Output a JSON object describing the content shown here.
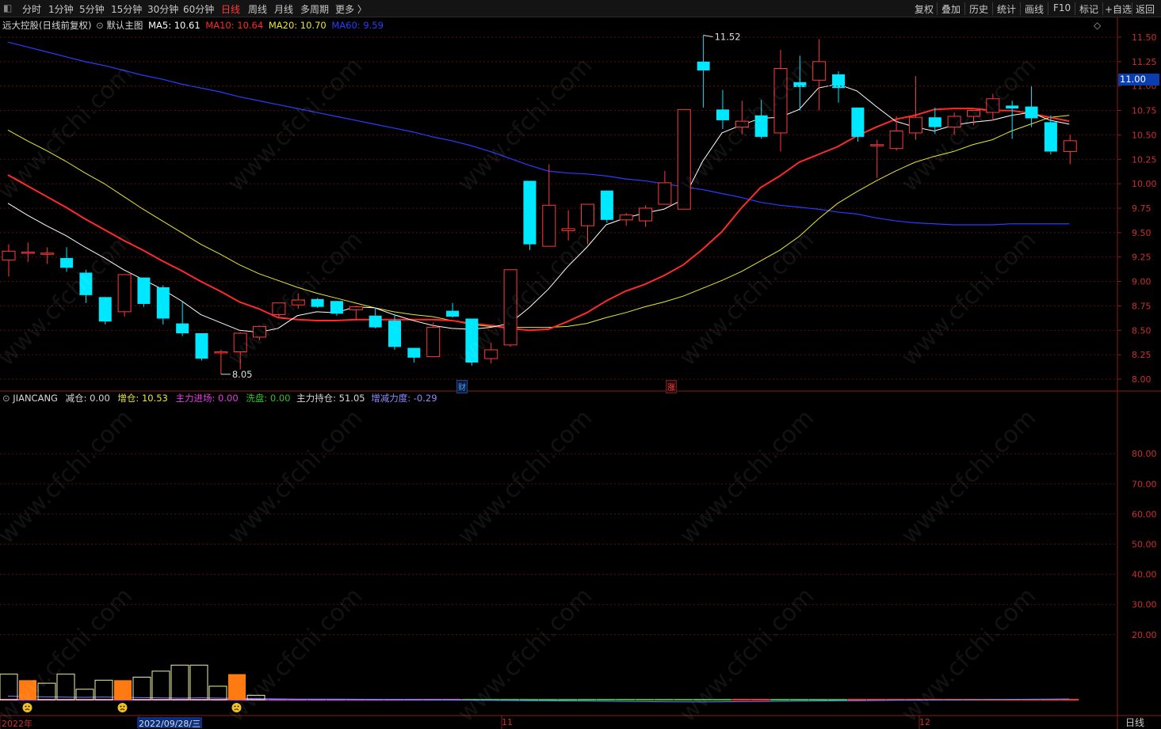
{
  "toolbar": {
    "collapse_icon": "collapse-icon",
    "periods": [
      "分时",
      "1分钟",
      "5分钟",
      "15分钟",
      "30分钟",
      "60分钟",
      "日线",
      "周线",
      "月线",
      "多周期",
      "更多 〉"
    ],
    "active_period": "日线",
    "right_buttons": [
      "复权",
      "叠加",
      "历史",
      "统计",
      "画线",
      "F10",
      "标记",
      "+自选",
      "返回"
    ]
  },
  "main_legend": {
    "stock": "远大控股",
    "mode": "(日线前复权)",
    "chart_name": "默认主图",
    "ma5": "MA5: 10.61",
    "ma10": "MA10: 10.64",
    "ma20": "MA20: 10.70",
    "ma60": "MA60: 9.59",
    "colors": {
      "ma5": "#ffffff",
      "ma10": "#ff2a2a",
      "ma20": "#e8e830",
      "ma60": "#2a3cff"
    }
  },
  "sub_legend": {
    "name": "JIANCANG",
    "jiancang": "减仓: 0.00",
    "zengcang": "增仓: 10.53",
    "zhuli_jinchang": "主力进场: 0.00",
    "xipan": "洗盘: 0.00",
    "zhuli_chicang": "主力持仓: 51.05",
    "zengjian_lidu": "增减力度: -0.29"
  },
  "price_axis": [
    "11.50",
    "11.25",
    "11.00",
    "10.75",
    "10.50",
    "10.25",
    "10.00",
    "9.75",
    "9.50",
    "9.25",
    "9.00",
    "8.75",
    "8.50",
    "8.25",
    "8.00"
  ],
  "indicator_axis": [
    "80.00",
    "70.00",
    "60.00",
    "50.00",
    "40.00",
    "30.00",
    "20.00"
  ],
  "current_price_label": "11.00",
  "high_annotation": "11.52",
  "low_annotation": "8.05",
  "markers": {
    "cai": "财",
    "zhang": "涨"
  },
  "x_labels": {
    "year": "2022年",
    "cursor_date": "2022/09/28/三",
    "nov": "11",
    "dec": "12"
  },
  "period_label": "日线",
  "watermark": "www.cfchi.com",
  "chart_data": {
    "type": "candlestick",
    "price_range": [
      8.0,
      11.5
    ],
    "candles": [
      {
        "o": 9.22,
        "h": 9.38,
        "l": 9.05,
        "c": 9.31
      },
      {
        "o": 9.3,
        "h": 9.4,
        "l": 9.2,
        "c": 9.3
      },
      {
        "o": 9.28,
        "h": 9.35,
        "l": 9.18,
        "c": 9.29
      },
      {
        "o": 9.24,
        "h": 9.35,
        "l": 9.1,
        "c": 9.14
      },
      {
        "o": 9.09,
        "h": 9.12,
        "l": 8.78,
        "c": 8.86
      },
      {
        "o": 8.84,
        "h": 8.84,
        "l": 8.56,
        "c": 8.59
      },
      {
        "o": 8.69,
        "h": 9.07,
        "l": 8.64,
        "c": 9.07
      },
      {
        "o": 9.04,
        "h": 9.04,
        "l": 8.74,
        "c": 8.77
      },
      {
        "o": 8.94,
        "h": 8.96,
        "l": 8.56,
        "c": 8.62
      },
      {
        "o": 8.57,
        "h": 8.79,
        "l": 8.44,
        "c": 8.47
      },
      {
        "o": 8.47,
        "h": 8.47,
        "l": 8.19,
        "c": 8.21
      },
      {
        "o": 8.28,
        "h": 8.3,
        "l": 8.05,
        "c": 8.28
      },
      {
        "o": 8.28,
        "h": 8.48,
        "l": 8.1,
        "c": 8.47
      },
      {
        "o": 8.43,
        "h": 8.55,
        "l": 8.4,
        "c": 8.54
      },
      {
        "o": 8.66,
        "h": 8.78,
        "l": 8.63,
        "c": 8.78
      },
      {
        "o": 8.76,
        "h": 8.88,
        "l": 8.72,
        "c": 8.81
      },
      {
        "o": 8.82,
        "h": 8.83,
        "l": 8.73,
        "c": 8.74
      },
      {
        "o": 8.8,
        "h": 8.8,
        "l": 8.65,
        "c": 8.67
      },
      {
        "o": 8.71,
        "h": 8.75,
        "l": 8.6,
        "c": 8.74
      },
      {
        "o": 8.65,
        "h": 8.73,
        "l": 8.52,
        "c": 8.53
      },
      {
        "o": 8.6,
        "h": 8.66,
        "l": 8.3,
        "c": 8.33
      },
      {
        "o": 8.32,
        "h": 8.32,
        "l": 8.17,
        "c": 8.22
      },
      {
        "o": 8.23,
        "h": 8.58,
        "l": 8.23,
        "c": 8.53
      },
      {
        "o": 8.7,
        "h": 8.78,
        "l": 8.63,
        "c": 8.64
      },
      {
        "o": 8.62,
        "h": 8.62,
        "l": 8.14,
        "c": 8.17
      },
      {
        "o": 8.21,
        "h": 8.37,
        "l": 8.16,
        "c": 8.3
      },
      {
        "o": 8.35,
        "h": 9.12,
        "l": 8.33,
        "c": 9.12
      },
      {
        "o": 10.03,
        "h": 10.03,
        "l": 9.32,
        "c": 9.38
      },
      {
        "o": 9.36,
        "h": 10.2,
        "l": 9.36,
        "c": 9.78
      },
      {
        "o": 9.52,
        "h": 9.73,
        "l": 9.42,
        "c": 9.54
      },
      {
        "o": 9.57,
        "h": 9.79,
        "l": 9.38,
        "c": 9.79
      },
      {
        "o": 9.93,
        "h": 9.93,
        "l": 9.6,
        "c": 9.63
      },
      {
        "o": 9.63,
        "h": 9.7,
        "l": 9.57,
        "c": 9.68
      },
      {
        "o": 9.62,
        "h": 9.78,
        "l": 9.56,
        "c": 9.75
      },
      {
        "o": 9.79,
        "h": 10.13,
        "l": 9.79,
        "c": 10.01
      },
      {
        "o": 9.74,
        "h": 10.76,
        "l": 9.74,
        "c": 10.76
      },
      {
        "o": 11.25,
        "h": 11.52,
        "l": 10.78,
        "c": 11.16
      },
      {
        "o": 10.76,
        "h": 10.96,
        "l": 10.56,
        "c": 10.65
      },
      {
        "o": 10.58,
        "h": 10.85,
        "l": 10.51,
        "c": 10.64
      },
      {
        "o": 10.7,
        "h": 10.86,
        "l": 10.46,
        "c": 10.48
      },
      {
        "o": 10.52,
        "h": 11.37,
        "l": 10.33,
        "c": 11.18
      },
      {
        "o": 11.04,
        "h": 11.31,
        "l": 10.75,
        "c": 10.99
      },
      {
        "o": 11.06,
        "h": 11.48,
        "l": 10.75,
        "c": 11.25
      },
      {
        "o": 11.12,
        "h": 11.15,
        "l": 10.83,
        "c": 10.98
      },
      {
        "o": 10.78,
        "h": 10.78,
        "l": 10.43,
        "c": 10.48
      },
      {
        "o": 10.4,
        "h": 10.45,
        "l": 10.06,
        "c": 10.4
      },
      {
        "o": 10.36,
        "h": 10.69,
        "l": 10.34,
        "c": 10.54
      },
      {
        "o": 10.52,
        "h": 11.1,
        "l": 10.45,
        "c": 10.68
      },
      {
        "o": 10.68,
        "h": 10.78,
        "l": 10.51,
        "c": 10.58
      },
      {
        "o": 10.58,
        "h": 10.73,
        "l": 10.5,
        "c": 10.69
      },
      {
        "o": 10.69,
        "h": 10.75,
        "l": 10.6,
        "c": 10.75
      },
      {
        "o": 10.73,
        "h": 10.92,
        "l": 10.65,
        "c": 10.87
      },
      {
        "o": 10.8,
        "h": 10.85,
        "l": 10.46,
        "c": 10.77
      },
      {
        "o": 10.79,
        "h": 11.0,
        "l": 10.58,
        "c": 10.67
      },
      {
        "o": 10.63,
        "h": 10.7,
        "l": 10.3,
        "c": 10.33
      },
      {
        "o": 10.33,
        "h": 10.5,
        "l": 10.2,
        "c": 10.44
      }
    ],
    "ma5": [
      9.8,
      9.68,
      9.57,
      9.47,
      9.35,
      9.24,
      9.12,
      9.02,
      8.92,
      8.8,
      8.66,
      8.58,
      8.5,
      8.48,
      8.52,
      8.65,
      8.69,
      8.68,
      8.74,
      8.73,
      8.66,
      8.6,
      8.55,
      8.52,
      8.51,
      8.53,
      8.57,
      8.73,
      8.92,
      9.15,
      9.35,
      9.58,
      9.65,
      9.7,
      9.74,
      9.84,
      10.23,
      10.52,
      10.6,
      10.67,
      10.68,
      10.76,
      10.98,
      11.02,
      10.95,
      10.79,
      10.64,
      10.58,
      10.54,
      10.6,
      10.63,
      10.65,
      10.7,
      10.73,
      10.65,
      10.61
    ],
    "ma10": [
      10.09,
      9.98,
      9.87,
      9.76,
      9.64,
      9.53,
      9.42,
      9.32,
      9.21,
      9.11,
      9.0,
      8.9,
      8.79,
      8.72,
      8.63,
      8.61,
      8.6,
      8.6,
      8.61,
      8.61,
      8.61,
      8.61,
      8.61,
      8.6,
      8.57,
      8.55,
      8.52,
      8.5,
      8.51,
      8.59,
      8.68,
      8.8,
      8.9,
      8.97,
      9.06,
      9.17,
      9.33,
      9.51,
      9.75,
      9.96,
      10.08,
      10.22,
      10.3,
      10.38,
      10.49,
      10.58,
      10.66,
      10.7,
      10.76,
      10.77,
      10.77,
      10.75,
      10.75,
      10.72,
      10.68,
      10.64
    ],
    "ma20": [
      10.55,
      10.44,
      10.34,
      10.23,
      10.11,
      10.0,
      9.87,
      9.74,
      9.62,
      9.5,
      9.38,
      9.28,
      9.17,
      9.08,
      9.01,
      8.94,
      8.88,
      8.83,
      8.78,
      8.73,
      8.69,
      8.66,
      8.64,
      8.6,
      8.56,
      8.54,
      8.53,
      8.53,
      8.53,
      8.54,
      8.57,
      8.63,
      8.68,
      8.74,
      8.79,
      8.85,
      8.93,
      9.01,
      9.1,
      9.21,
      9.32,
      9.46,
      9.64,
      9.8,
      9.92,
      10.03,
      10.13,
      10.22,
      10.28,
      10.33,
      10.4,
      10.45,
      10.54,
      10.61,
      10.68,
      10.7
    ],
    "ma60": [
      11.45,
      11.4,
      11.35,
      11.3,
      11.25,
      11.21,
      11.16,
      11.11,
      11.07,
      11.02,
      10.98,
      10.94,
      10.89,
      10.85,
      10.81,
      10.77,
      10.73,
      10.69,
      10.65,
      10.61,
      10.57,
      10.53,
      10.48,
      10.44,
      10.39,
      10.33,
      10.26,
      10.19,
      10.13,
      10.11,
      10.1,
      10.08,
      10.05,
      10.03,
      10.0,
      9.97,
      9.94,
      9.9,
      9.86,
      9.81,
      9.78,
      9.76,
      9.74,
      9.71,
      9.69,
      9.65,
      9.62,
      9.6,
      9.59,
      9.58,
      9.58,
      9.58,
      9.59,
      9.59,
      9.59,
      9.59
    ],
    "indicator": {
      "range": [
        0,
        100
      ],
      "bars": [
        {
          "type": "hollow",
          "v": 9
        },
        {
          "type": "orange",
          "v": 7
        },
        {
          "type": "hollow",
          "v": 6
        },
        {
          "type": "hollow",
          "v": 9
        },
        {
          "type": "hollow",
          "v": 4
        },
        {
          "type": "hollow",
          "v": 7
        },
        {
          "type": "orange",
          "v": 7
        },
        {
          "type": "hollow",
          "v": 8
        },
        {
          "type": "hollow",
          "v": 10
        },
        {
          "type": "hollow",
          "v": 12
        },
        {
          "type": "hollow",
          "v": 12
        },
        {
          "type": "hollow",
          "v": 5
        },
        {
          "type": "orange",
          "v": 9
        },
        {
          "type": "hollow",
          "v": 2
        }
      ],
      "sad_faces_at": [
        1,
        6,
        12
      ],
      "line_blue": [
        4.5,
        4.0,
        3.6,
        3.2,
        3.0,
        3.4,
        3.0,
        2.6,
        2.2,
        2.0,
        2.4,
        2.0,
        1.6,
        1.2,
        1.0,
        0.8,
        0.8,
        0.8,
        0.6,
        0.4,
        0.2,
        0.0,
        -0.2,
        -0.4,
        -0.6,
        -0.8,
        -1.0,
        -1.2,
        -1.4,
        -1.6,
        -1.8,
        -2.0,
        -2.2,
        -2.4,
        -2.6,
        -2.8,
        -2.8,
        -2.6,
        -2.4,
        -2.2,
        -2.0,
        -1.8,
        -1.6,
        -1.4,
        -1.2,
        -1.0,
        -0.8,
        -0.6,
        -0.4,
        -0.2,
        0.0,
        0.2,
        0.4,
        0.6,
        0.8,
        1.0
      ],
      "baseline_colors": [
        "#e040e0",
        "#e040e0",
        "#e040e0",
        "#e040e0",
        "#e040e0",
        "#e040e0",
        "#e040e0",
        "#e040e0",
        "#e040e0",
        "#e040e0",
        "#e040e0",
        "#e040e0",
        "#e040e0",
        "#e040e0",
        "#e040e0",
        "#e040e0",
        "#e040e0",
        "#e040e0",
        "#e040e0",
        "#e040e0",
        "#e040e0",
        "#e040e0",
        "#e040e0",
        "#e040e0",
        "#30c030",
        "#30c030",
        "#30c030",
        "#30c030",
        "#30c030",
        "#30c030",
        "#30c030",
        "#30c030",
        "#30c030",
        "#30c030",
        "#30c030",
        "#30c030",
        "#30c030",
        "#30c030",
        "#ff3030",
        "#ff3030",
        "#30c030",
        "#30c030",
        "#30c030",
        "#30c030",
        "#ff3030",
        "#ff3030",
        "#ff3030",
        "#ff3030",
        "#ff3030",
        "#ff3030",
        "#ff3030",
        "#ff3030",
        "#ff3030",
        "#ff3030",
        "#ff3030",
        "#ff3030"
      ]
    }
  }
}
